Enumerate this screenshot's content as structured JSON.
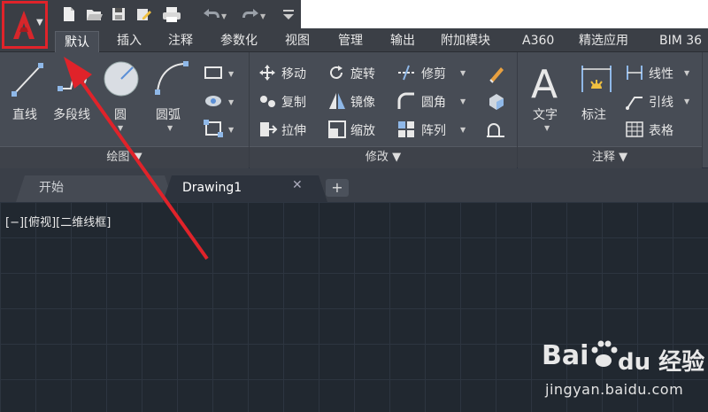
{
  "quick_access": {
    "icons": [
      "new-icon",
      "open-icon",
      "save-icon",
      "saveas-icon",
      "print-icon",
      "undo-icon",
      "redo-icon",
      "customize-icon"
    ]
  },
  "ribbon_tabs": [
    {
      "label": "默认",
      "active": true
    },
    {
      "label": "插入"
    },
    {
      "label": "注释"
    },
    {
      "label": "参数化"
    },
    {
      "label": "视图"
    },
    {
      "label": "管理"
    },
    {
      "label": "输出"
    },
    {
      "label": "附加模块"
    },
    {
      "label": "A360"
    },
    {
      "label": "精选应用"
    },
    {
      "label": "BIM 36"
    }
  ],
  "draw_panel": {
    "title": "绘图",
    "line": "直线",
    "polyline": "多段线",
    "circle": "圆",
    "arc": "圆弧"
  },
  "modify_panel": {
    "title": "修改",
    "move": "移动",
    "rotate": "旋转",
    "trim": "修剪",
    "copy": "复制",
    "mirror": "镜像",
    "fillet": "圆角",
    "stretch": "拉伸",
    "scale": "缩放",
    "array": "阵列"
  },
  "annotation_panel": {
    "title": "注释",
    "text": "文字",
    "dimension": "标注",
    "linear": "线性",
    "leader": "引线",
    "table": "表格"
  },
  "doc_tabs": [
    {
      "label": "开始"
    },
    {
      "label": "Drawing1",
      "active": true
    }
  ],
  "viewport_label": "[−][俯视][二维线框]",
  "watermark": {
    "brand": "Bai du 经验",
    "url": "jingyan.baidu.com"
  },
  "colors": {
    "highlight": "#e0232a",
    "ribbon": "#474c55",
    "canvas": "#212830"
  }
}
